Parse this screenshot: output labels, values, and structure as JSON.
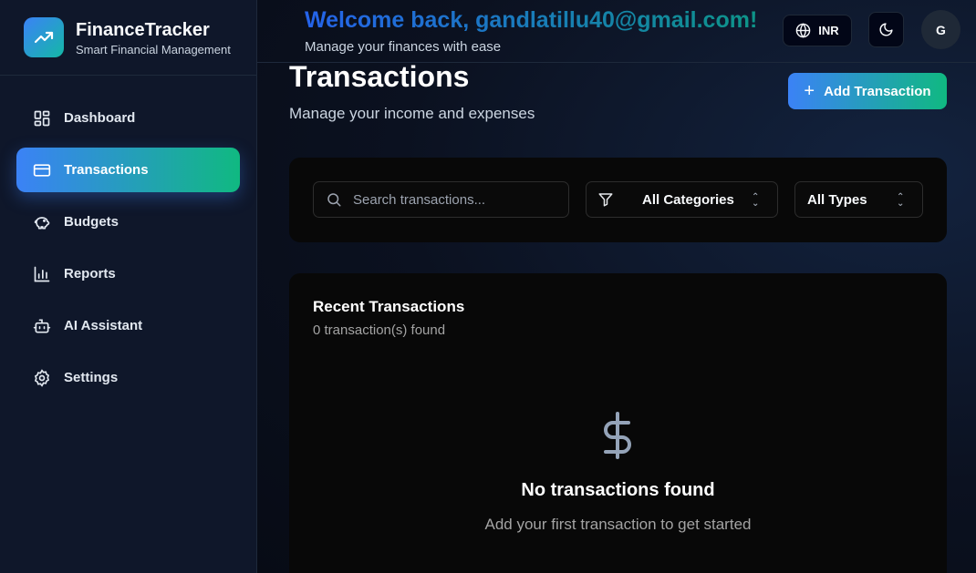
{
  "brand": {
    "name": "FinanceTracker",
    "subtitle": "Smart Financial Management",
    "logo_icon": "trending-up-icon"
  },
  "sidebar": {
    "items": [
      {
        "label": "Dashboard",
        "icon": "dashboard-icon",
        "active": false
      },
      {
        "label": "Transactions",
        "icon": "credit-card-icon",
        "active": true
      },
      {
        "label": "Budgets",
        "icon": "piggy-bank-icon",
        "active": false
      },
      {
        "label": "Reports",
        "icon": "bar-chart-icon",
        "active": false
      },
      {
        "label": "AI Assistant",
        "icon": "bot-icon",
        "active": false
      },
      {
        "label": "Settings",
        "icon": "gear-icon",
        "active": false
      }
    ]
  },
  "header": {
    "welcome": "Welcome back, gandlatillu40@gmail.com!",
    "subtitle": "Manage your finances with ease",
    "currency": "INR",
    "avatar_initial": "G"
  },
  "page": {
    "title": "Transactions",
    "subtitle": "Manage your income and expenses",
    "add_button": "Add Transaction"
  },
  "filters": {
    "search_placeholder": "Search transactions...",
    "category": "All Categories",
    "type": "All Types"
  },
  "list": {
    "title": "Recent Transactions",
    "count": "0 transaction(s) found",
    "empty_title": "No transactions found",
    "empty_subtitle": "Add your first transaction to get started"
  },
  "colors": {
    "accent_start": "#3b82f6",
    "accent_end": "#10b981",
    "background": "#0b1120"
  }
}
